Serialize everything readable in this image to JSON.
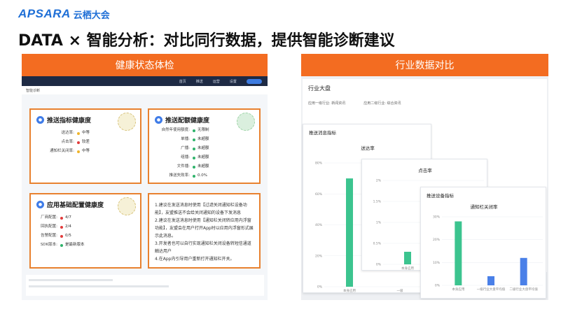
{
  "logo": {
    "mark": "APSARA",
    "cn": "云栖大会"
  },
  "headline": "DATA × 智能分析：对比同行数据，提供智能诊断建议",
  "left_panel": {
    "banner": "健康状态体检",
    "nav": [
      "首页",
      "推送",
      "运营",
      "设置"
    ],
    "subhead": "智能诊断",
    "cards": {
      "push_metrics": {
        "title": "推送指标健康度",
        "rows": [
          {
            "k": "送达率:",
            "v": "中等",
            "color": "#f0b52b"
          },
          {
            "k": "点击率:",
            "v": "较差",
            "color": "#e23b3b"
          },
          {
            "k": "通知栏关闭率:",
            "v": "中等",
            "color": "#f0b52b"
          }
        ]
      },
      "push_config": {
        "title": "推送配额健康度",
        "rows": [
          {
            "k": "自然年使用额度:",
            "v": "无限制",
            "color": "#2fb36b"
          },
          {
            "k": "单播:",
            "v": "未超额",
            "color": "#2fb36b"
          },
          {
            "k": "广播:",
            "v": "未超额",
            "color": "#2fb36b"
          },
          {
            "k": "组播:",
            "v": "未超额",
            "color": "#2fb36b"
          },
          {
            "k": "文件播:",
            "v": "未超额",
            "color": "#2fb36b"
          },
          {
            "k": "推送失败率:",
            "v": "0.0%",
            "color": "#2fb36b"
          }
        ]
      },
      "app_config": {
        "title": "应用基础配置健康度",
        "rows": [
          {
            "k": "厂商配置:",
            "v": "4/7",
            "color": "#e23b3b"
          },
          {
            "k": "回执配置:",
            "v": "2/4",
            "color": "#e23b3b"
          },
          {
            "k": "告警配置:",
            "v": "0/5",
            "color": "#e23b3b"
          },
          {
            "k": "SDK版本:",
            "v": "是最新版本",
            "color": "#2fb36b"
          }
        ]
      },
      "advice": [
        "1.建议在发送消息时使用【过滤关闭通知栏设备功能】，友盟推送不会给关闭通知的设备下发消息",
        "2.建议在发送消息时使用【通知栏关闭转应用内浮窗功能】，友盟会在用户打开App时以应用内浮窗形式展示此消息。",
        "3.开发者也可以自行实现通知栏关闭设备转短信通道触达用户",
        "4.在App内引导用户重新打开通知栏开关。"
      ]
    }
  },
  "right_panel": {
    "banner": "行业数据对比",
    "industry_title": "行业大盘",
    "filters": [
      "应用一级行业: 新闻资讯",
      "应用二级行业: 综合资讯"
    ],
    "section_title": "推送消息指标",
    "section_title_2": "推送设备指标"
  },
  "chart_data": [
    {
      "type": "bar",
      "title": "送达率",
      "categories": [
        "本身应用",
        "一级"
      ],
      "values": [
        70,
        0
      ],
      "ylim": [
        0,
        80
      ],
      "yticks": [
        "0%",
        "20%",
        "40%",
        "60%",
        "80%"
      ],
      "colors": [
        "#3cc48f",
        "#3cc48f"
      ]
    },
    {
      "type": "bar",
      "title": "点击率",
      "categories": [
        "本身应用",
        "一级"
      ],
      "values": [
        0.3,
        0
      ],
      "ylim": [
        0,
        2
      ],
      "yticks": [
        "0%",
        "0.5%",
        "1%",
        "1.5%",
        "2%"
      ],
      "colors": [
        "#3cc48f",
        "#3cc48f"
      ]
    },
    {
      "type": "bar",
      "title": "通知栏关闭率",
      "categories": [
        "本身应用",
        "一级行业大盘平均值",
        "二级行业大盘平均值"
      ],
      "values": [
        28,
        4,
        12
      ],
      "ylim": [
        0,
        30
      ],
      "yticks": [
        "0%",
        "10%",
        "20%",
        "30%"
      ],
      "colors": [
        "#3cc48f",
        "#4a80e8",
        "#4a80e8"
      ]
    }
  ]
}
